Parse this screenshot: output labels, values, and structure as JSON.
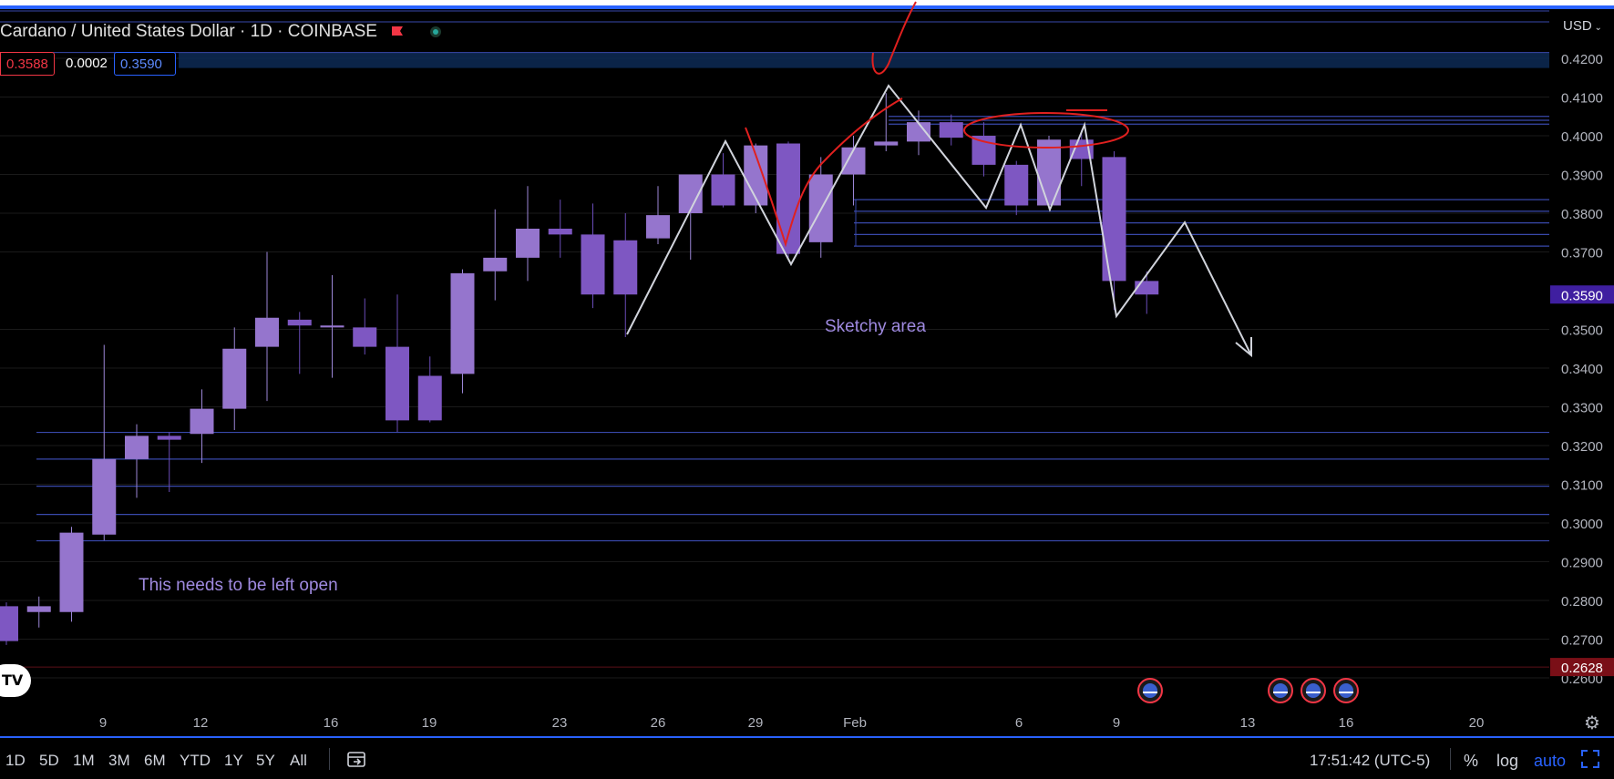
{
  "header": {
    "title": "Cardano / United States Dollar · 1D · COINBASE",
    "sell_price": "0.3588",
    "spread": "0.0002",
    "buy_price": "0.3590",
    "currency": "USD"
  },
  "toolbar": {
    "ranges": [
      "1D",
      "5D",
      "1M",
      "3M",
      "6M",
      "YTD",
      "1Y",
      "5Y",
      "All"
    ],
    "clock": "17:51:42 (UTC-5)",
    "percent_label": "%",
    "log_label": "log",
    "auto_label": "auto"
  },
  "colors": {
    "background": "#000000",
    "candle": "#7e57c2",
    "candle_light": "#9575cd",
    "horizontal_lines": "#3949ab",
    "zigzag": "#d1d4dc",
    "annotation_red": "#e0201f",
    "accent": "#2962ff",
    "last_price_badge": "#3f1fa0",
    "low_price_badge": "#7a0f17"
  },
  "chart_data": {
    "type": "candlestick",
    "symbol": "Cardano / United States Dollar",
    "interval": "1D",
    "exchange": "COINBASE",
    "ylim": [
      0.2585,
      0.4265
    ],
    "y_ticks": [
      "0.4200",
      "0.4100",
      "0.4000",
      "0.3900",
      "0.3800",
      "0.3700",
      "0.3500",
      "0.3400",
      "0.3300",
      "0.3200",
      "0.3100",
      "0.3000",
      "0.2900",
      "0.2800",
      "0.2700",
      "0.2600"
    ],
    "x_ticks": [
      "9",
      "12",
      "16",
      "19",
      "23",
      "26",
      "29",
      "Feb",
      "6",
      "9",
      "13",
      "16",
      "20"
    ],
    "last_price": "0.3590",
    "low_marker": "0.2628",
    "candles": [
      {
        "o": 0.2785,
        "h": 0.2795,
        "l": 0.2685,
        "c": 0.2695
      },
      {
        "o": 0.277,
        "h": 0.281,
        "l": 0.273,
        "c": 0.2785
      },
      {
        "o": 0.277,
        "h": 0.299,
        "l": 0.2745,
        "c": 0.2975
      },
      {
        "o": 0.297,
        "h": 0.346,
        "l": 0.2955,
        "c": 0.3165
      },
      {
        "o": 0.3165,
        "h": 0.3255,
        "l": 0.3065,
        "c": 0.3225
      },
      {
        "o": 0.3225,
        "h": 0.3235,
        "l": 0.308,
        "c": 0.3215
      },
      {
        "o": 0.323,
        "h": 0.3345,
        "l": 0.3155,
        "c": 0.3295
      },
      {
        "o": 0.3295,
        "h": 0.3505,
        "l": 0.324,
        "c": 0.345
      },
      {
        "o": 0.3455,
        "h": 0.37,
        "l": 0.3315,
        "c": 0.353
      },
      {
        "o": 0.3525,
        "h": 0.3545,
        "l": 0.3385,
        "c": 0.351
      },
      {
        "o": 0.3505,
        "h": 0.364,
        "l": 0.3375,
        "c": 0.351
      },
      {
        "o": 0.3505,
        "h": 0.358,
        "l": 0.3435,
        "c": 0.3455
      },
      {
        "o": 0.3455,
        "h": 0.359,
        "l": 0.3235,
        "c": 0.3265
      },
      {
        "o": 0.338,
        "h": 0.343,
        "l": 0.326,
        "c": 0.3265
      },
      {
        "o": 0.3385,
        "h": 0.3655,
        "l": 0.3335,
        "c": 0.3645
      },
      {
        "o": 0.365,
        "h": 0.381,
        "l": 0.3575,
        "c": 0.3685
      },
      {
        "o": 0.3685,
        "h": 0.387,
        "l": 0.3625,
        "c": 0.376
      },
      {
        "o": 0.376,
        "h": 0.3835,
        "l": 0.3685,
        "c": 0.3745
      },
      {
        "o": 0.3745,
        "h": 0.3825,
        "l": 0.3555,
        "c": 0.359
      },
      {
        "o": 0.373,
        "h": 0.38,
        "l": 0.348,
        "c": 0.359
      },
      {
        "o": 0.3735,
        "h": 0.387,
        "l": 0.372,
        "c": 0.3795
      },
      {
        "o": 0.38,
        "h": 0.39,
        "l": 0.368,
        "c": 0.39
      },
      {
        "o": 0.39,
        "h": 0.3955,
        "l": 0.3815,
        "c": 0.382
      },
      {
        "o": 0.382,
        "h": 0.398,
        "l": 0.38,
        "c": 0.3975
      },
      {
        "o": 0.398,
        "h": 0.3985,
        "l": 0.3685,
        "c": 0.3695
      },
      {
        "o": 0.3725,
        "h": 0.3945,
        "l": 0.3685,
        "c": 0.39
      },
      {
        "o": 0.39,
        "h": 0.4,
        "l": 0.382,
        "c": 0.397
      },
      {
        "o": 0.3975,
        "h": 0.411,
        "l": 0.396,
        "c": 0.3985
      },
      {
        "o": 0.3985,
        "h": 0.4065,
        "l": 0.395,
        "c": 0.4035
      },
      {
        "o": 0.4035,
        "h": 0.4055,
        "l": 0.3975,
        "c": 0.3995
      },
      {
        "o": 0.4,
        "h": 0.4035,
        "l": 0.3895,
        "c": 0.3925
      },
      {
        "o": 0.3925,
        "h": 0.3935,
        "l": 0.3795,
        "c": 0.382
      },
      {
        "o": 0.382,
        "h": 0.4,
        "l": 0.381,
        "c": 0.399
      },
      {
        "o": 0.399,
        "h": 0.4015,
        "l": 0.387,
        "c": 0.394
      },
      {
        "o": 0.3945,
        "h": 0.396,
        "l": 0.355,
        "c": 0.3625
      },
      {
        "o": 0.3625,
        "h": 0.365,
        "l": 0.354,
        "c": 0.359
      }
    ],
    "support_lines": [
      "0.3234",
      "0.3165",
      "0.3095",
      "0.3022",
      "0.2954"
    ],
    "resistance_lines": [
      "0.4050",
      "0.4040",
      "0.4030"
    ],
    "upper_band": [
      "0.4215",
      "0.4175"
    ],
    "mid_lines": [
      "0.3835",
      "0.3805",
      "0.3775",
      "0.3745",
      "0.3715"
    ],
    "annotations": [
      {
        "text": "Sketchy area"
      },
      {
        "text": "This needs to be left open"
      }
    ]
  }
}
